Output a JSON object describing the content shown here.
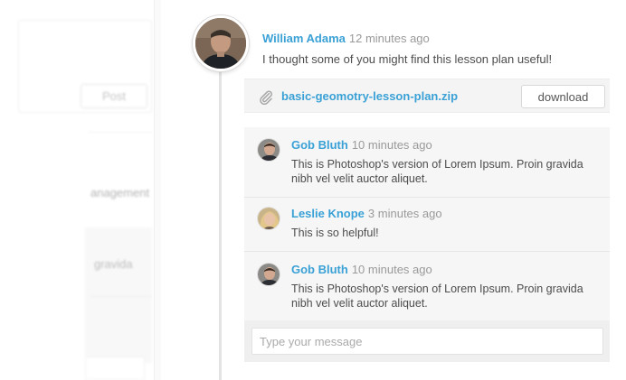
{
  "background": {
    "post_button_label": "Post",
    "manage_text": "anagement",
    "gravida_text": "gravida"
  },
  "post": {
    "author": "William Adama",
    "time": "12 minutes ago",
    "text": "I thought some of you might find this lesson plan useful!",
    "attachment": {
      "icon": "paperclip-icon",
      "filename": "basic-geomotry-lesson-plan.zip",
      "download_label": "download"
    }
  },
  "comments": [
    {
      "author": "Gob Bluth",
      "time": "10 minutes ago",
      "text": "This is Photoshop's version  of Lorem Ipsum. Proin gravida nibh vel velit auctor aliquet."
    },
    {
      "author": "Leslie Knope",
      "time": "3 minutes ago",
      "text": "This is so helpful!"
    },
    {
      "author": "Gob Bluth",
      "time": "10 minutes ago",
      "text": "This is Photoshop's version  of Lorem Ipsum. Proin gravida nibh vel velit auctor aliquet."
    }
  ],
  "composer": {
    "placeholder": "Type your message"
  },
  "colors": {
    "accent": "#3aa1d6",
    "muted": "#9a9a9a"
  }
}
